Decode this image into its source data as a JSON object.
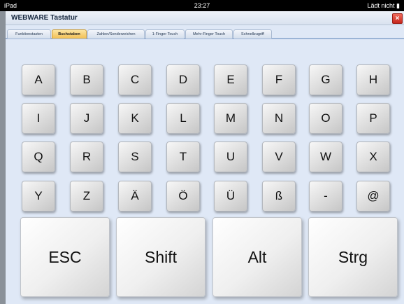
{
  "statusbar": {
    "device": "iPad",
    "time": "23:27",
    "battery": "Lädt nicht ▮"
  },
  "window": {
    "title": "WEBWARE Tastatur",
    "close_icon": "×"
  },
  "tabs": [
    {
      "label": "Funktionstasten",
      "active": false
    },
    {
      "label": "Buchstaben",
      "active": true
    },
    {
      "label": "Zahlen/Sonderzeichen",
      "active": false
    },
    {
      "label": "1-Finger Touch",
      "active": false
    },
    {
      "label": "Mehr-Finger Touch",
      "active": false
    },
    {
      "label": "Schnellzugriff",
      "active": false
    }
  ],
  "keys": {
    "row1": [
      "A",
      "B",
      "C",
      "D",
      "E",
      "F",
      "G",
      "H"
    ],
    "row2": [
      "I",
      "J",
      "K",
      "L",
      "M",
      "N",
      "O",
      "P"
    ],
    "row3": [
      "Q",
      "R",
      "S",
      "T",
      "U",
      "V",
      "W",
      "X"
    ],
    "row4": [
      "Y",
      "Z",
      "Ä",
      "Ö",
      "Ü",
      "ß",
      "-",
      "@"
    ]
  },
  "modifiers": [
    "ESC",
    "Shift",
    "Alt",
    "Strg"
  ],
  "colors": {
    "active_tab": "#f2bf53",
    "background": "#dfe8f6",
    "close_button": "#c6261d"
  }
}
